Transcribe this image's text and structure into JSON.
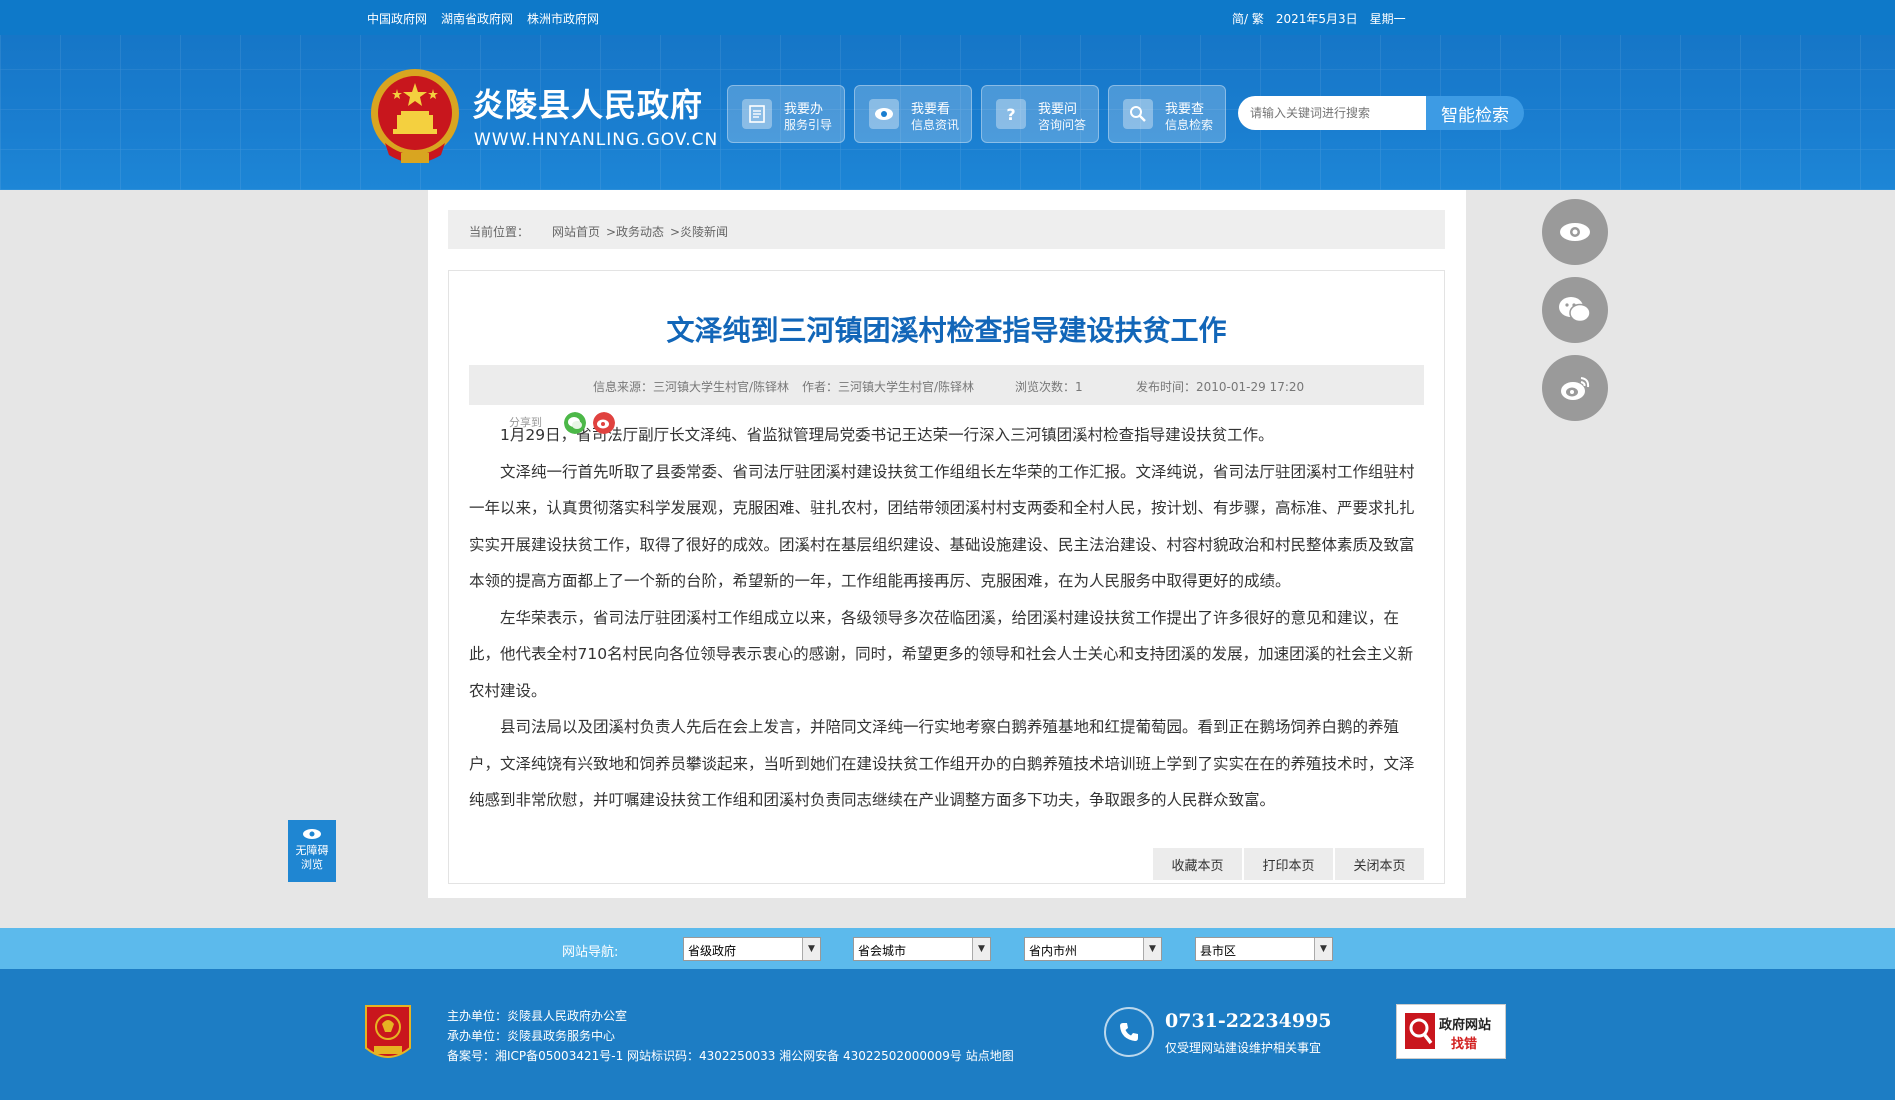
{
  "topbar": {
    "links": [
      "中国政府网",
      "湖南省政府网",
      "株洲市政府网"
    ],
    "lang": "简/ 繁",
    "date": "2021年5月3日",
    "weekday": "星期一"
  },
  "header": {
    "title": "炎陵县人民政府",
    "domain": "WWW.HNYANLING.GOV.CN",
    "nav": [
      {
        "line1": "我要办",
        "line2": "服务引导",
        "icon": "document-icon"
      },
      {
        "line1": "我要看",
        "line2": "信息资讯",
        "icon": "eye-icon"
      },
      {
        "line1": "我要问",
        "line2": "咨询问答",
        "icon": "question-icon"
      },
      {
        "line1": "我要查",
        "line2": "信息检索",
        "icon": "search-icon"
      }
    ],
    "search": {
      "placeholder": "请输入关键词进行搜索",
      "button": "智能检索"
    }
  },
  "breadcrumb": {
    "prefix": "当前位置：",
    "items": [
      "网站首页",
      ">政务动态",
      ">炎陵新闻"
    ]
  },
  "article": {
    "title": "文泽纯到三河镇团溪村检查指导建设扶贫工作",
    "source": "信息来源：三河镇大学生村官/陈铎林",
    "author": "作者：三河镇大学生村官/陈铎林",
    "views": "浏览次数：1",
    "published": "发布时间：2010-01-29 17:20",
    "share_label": "分享到",
    "paragraphs": [
      "1月29日，省司法厅副厅长文泽纯、省监狱管理局党委书记王达荣一行深入三河镇团溪村检查指导建设扶贫工作。",
      "文泽纯一行首先听取了县委常委、省司法厅驻团溪村建设扶贫工作组组长左华荣的工作汇报。文泽纯说，省司法厅驻团溪村工作组驻村一年以来，认真贯彻落实科学发展观，克服困难、驻扎农村，团结带领团溪村村支两委和全村人民，按计划、有步骤，高标准、严要求扎扎实实开展建设扶贫工作，取得了很好的成效。团溪村在基层组织建设、基础设施建设、民主法治建设、村容村貌政治和村民整体素质及致富本领的提高方面都上了一个新的台阶，希望新的一年，工作组能再接再厉、克服困难，在为人民服务中取得更好的成绩。",
      "左华荣表示，省司法厅驻团溪村工作组成立以来，各级领导多次莅临团溪，给团溪村建设扶贫工作提出了许多很好的意见和建议，在此，他代表全村710名村民向各位领导表示衷心的感谢，同时，希望更多的领导和社会人士关心和支持团溪的发展，加速团溪的社会主义新农村建设。",
      "县司法局以及团溪村负责人先后在会上发言，并陪同文泽纯一行实地考察白鹅养殖基地和红提葡萄园。看到正在鹅场饲养白鹅的养殖户，文泽纯饶有兴致地和饲养员攀谈起来，当听到她们在建设扶贫工作组开办的白鹅养殖技术培训班上学到了实实在在的养殖技术时，文泽纯感到非常欣慰，并叮嘱建设扶贫工作组和团溪村负责同志继续在产业调整方面多下功夫，争取跟多的人民群众致富。"
    ],
    "actions": [
      "收藏本页",
      "打印本页",
      "关闭本页"
    ]
  },
  "float_buttons": [
    "eye-icon",
    "wechat-icon",
    "weibo-icon"
  ],
  "accessibility": {
    "line1": "无障碍",
    "line2": "浏览"
  },
  "sitenav": {
    "label": "网站导航:",
    "selects": [
      "省级政府",
      "省会城市",
      "省内市州",
      "县市区"
    ]
  },
  "footer": {
    "sponsor": "主办单位：炎陵县人民政府办公室",
    "organizer": "承办单位：炎陵县政务服务中心",
    "record": "备案号：湘ICP备05003421号-1 网站标识码：4302250033 湘公网安备 43022502000009号 站点地图",
    "phone": "0731-22234995",
    "phone_note": "仅受理网站建设维护相关事宜",
    "error_badge": {
      "line1": "政府网站",
      "line2": "找错"
    }
  },
  "colors": {
    "brand_blue": "#0e79c9",
    "title_blue": "#1266b8",
    "nav_light": "#5cbaec",
    "footer": "#1d7dc4"
  }
}
